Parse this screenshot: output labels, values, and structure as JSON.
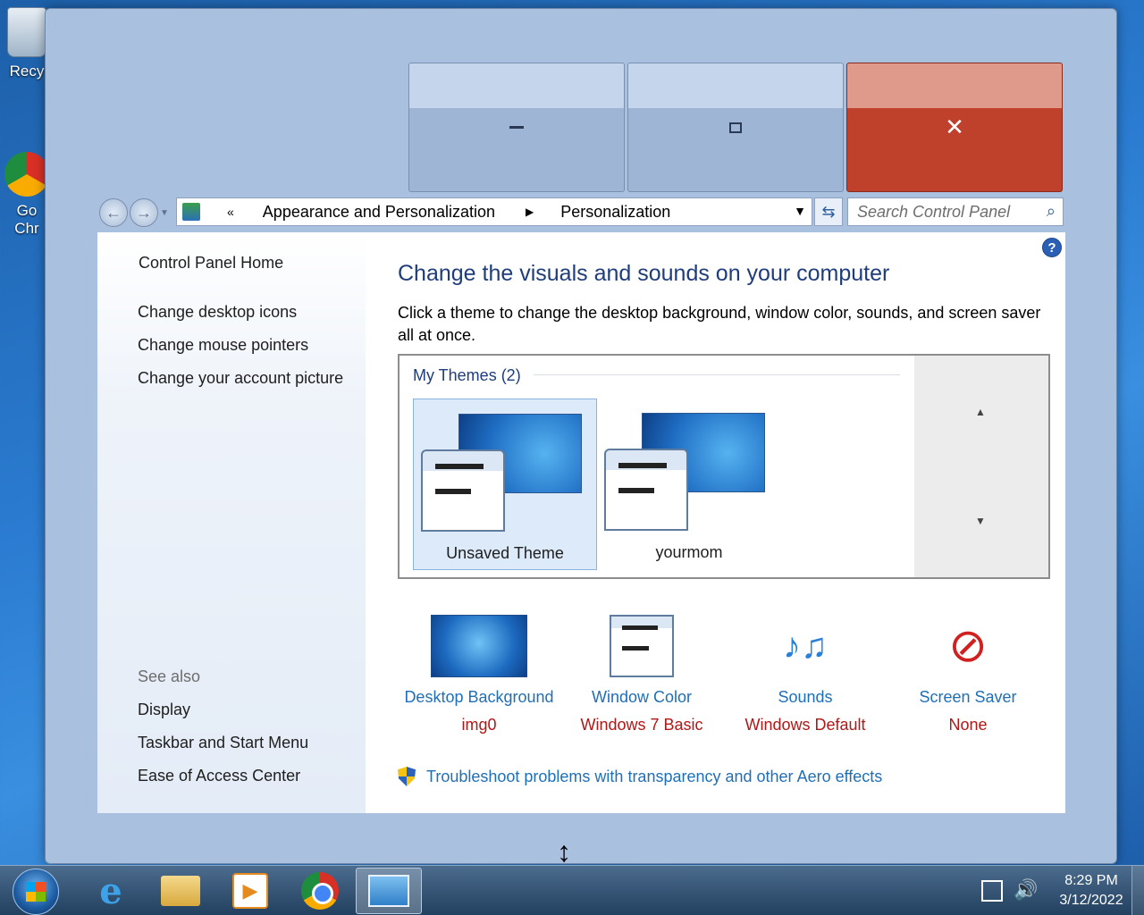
{
  "desktop": {
    "icons": [
      {
        "label": "Recy"
      },
      {
        "label_line1": "Go",
        "label_line2": "Chr"
      }
    ]
  },
  "window": {
    "caption_buttons": {
      "minimize": "—",
      "maximize": "□",
      "close": "✕"
    }
  },
  "navbar": {
    "back": "←",
    "forward": "→",
    "breadcrumb_chevron": "«",
    "crumbs": [
      "Appearance and Personalization",
      "Personalization"
    ],
    "crumb_separator": "▶",
    "dropdown": "▼",
    "refresh": "⇆",
    "search_placeholder": "Search Control Panel",
    "search_icon": "⌕"
  },
  "sidebar": {
    "home": "Control Panel Home",
    "tasks": [
      "Change desktop icons",
      "Change mouse pointers",
      "Change your account picture"
    ],
    "see_also_heading": "See also",
    "see_also": [
      "Display",
      "Taskbar and Start Menu",
      "Ease of Access Center"
    ]
  },
  "main": {
    "help": "?",
    "title": "Change the visuals and sounds on your computer",
    "description": "Click a theme to change the desktop background, window color, sounds, and screen saver all at once.",
    "themes_heading": "My Themes (2)",
    "themes": [
      {
        "name": "Unsaved Theme",
        "selected": true
      },
      {
        "name": "yourmom",
        "selected": false
      }
    ],
    "scroll_up": "▲",
    "scroll_down": "▼",
    "options": [
      {
        "name": "Desktop Background",
        "value": "img0",
        "icon": "desktop-background-icon"
      },
      {
        "name": "Window Color",
        "value": "Windows 7 Basic",
        "icon": "window-color-icon"
      },
      {
        "name": "Sounds",
        "value": "Windows Default",
        "icon": "sounds-icon",
        "glyph": "♪♫"
      },
      {
        "name": "Screen Saver",
        "value": "None",
        "icon": "screen-saver-icon",
        "glyph": "⊘"
      }
    ],
    "troubleshoot": "Troubleshoot problems with transparency and other Aero effects"
  },
  "cursor": "↕",
  "taskbar": {
    "ie_glyph": "e",
    "media_glyph": "▶",
    "clock_time": "8:29 PM",
    "clock_date": "3/12/2022",
    "volume_glyph": "🔊"
  },
  "colors": {
    "link": "#1f6fb8",
    "value_red": "#b01818",
    "title_blue": "#1e3d7a",
    "close_red": "#c0412b"
  }
}
